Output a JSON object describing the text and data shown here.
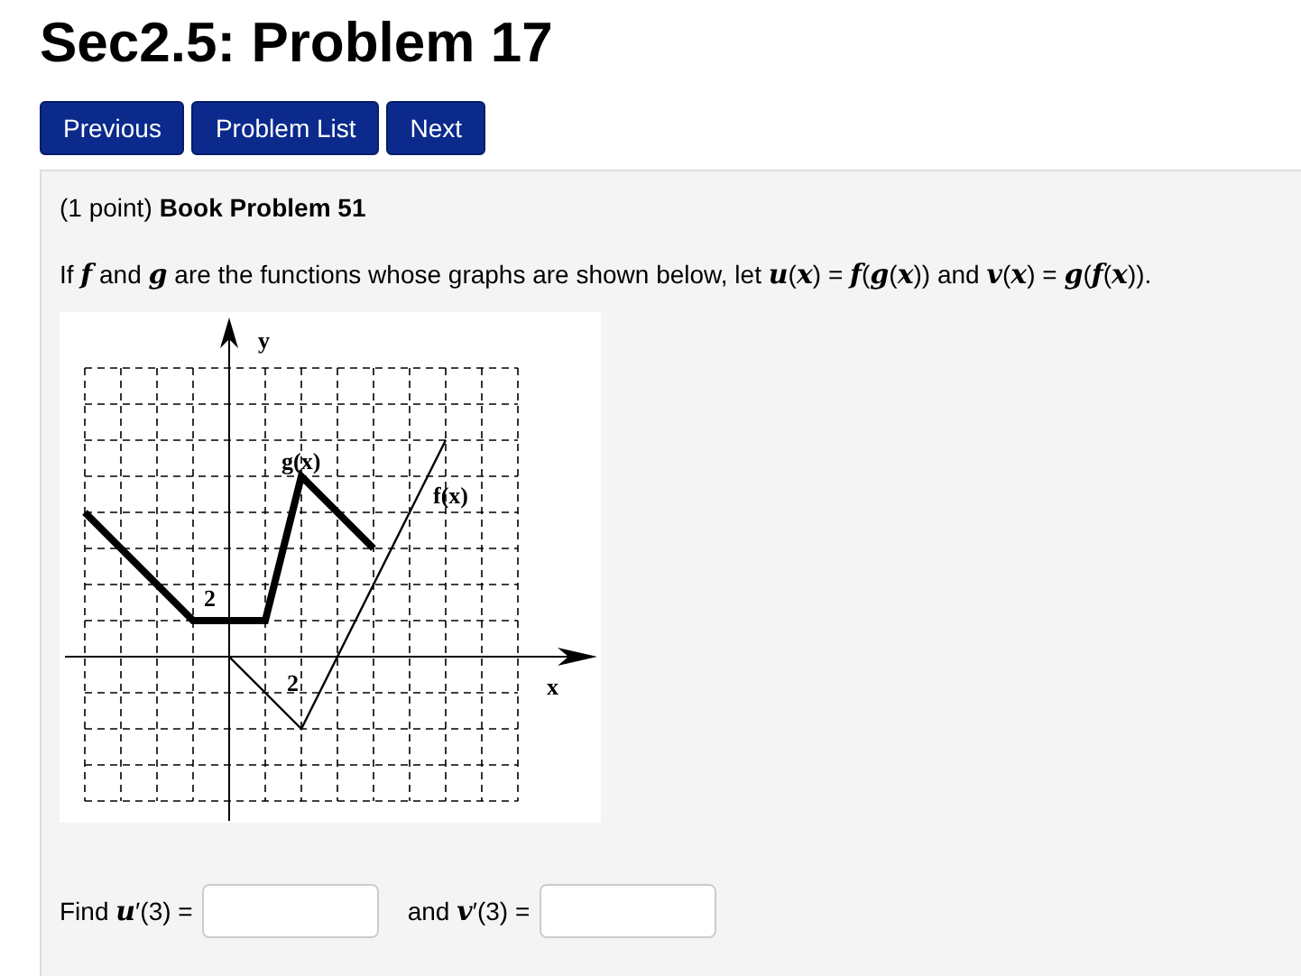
{
  "title": "Sec2.5: Problem 17",
  "nav_buttons": [
    "Previous",
    "Problem List",
    "Next"
  ],
  "problem": {
    "points": "(1 point)",
    "name": "Book Problem 51",
    "statement": "If *f* and *g* are the functions whose graphs are shown below, let *u*(*x*) = *f*(*g*(*x*)) and *v*(*x*) = *g*(*f*(*x*)).",
    "graph": {
      "labels": [
        {
          "kind": "y-axis",
          "text": "y"
        },
        {
          "kind": "x-axis",
          "text": "x"
        },
        {
          "kind": "g",
          "text": "g(x)"
        },
        {
          "kind": "f",
          "text": "f(x)"
        },
        {
          "kind": "y-tick",
          "text": "2"
        },
        {
          "kind": "x-tick",
          "text": "2"
        }
      ]
    },
    "answers": [
      {
        "prompt": "Find *u*′(3) ="
      },
      {
        "prompt": "and *v*′(3) ="
      }
    ]
  }
}
